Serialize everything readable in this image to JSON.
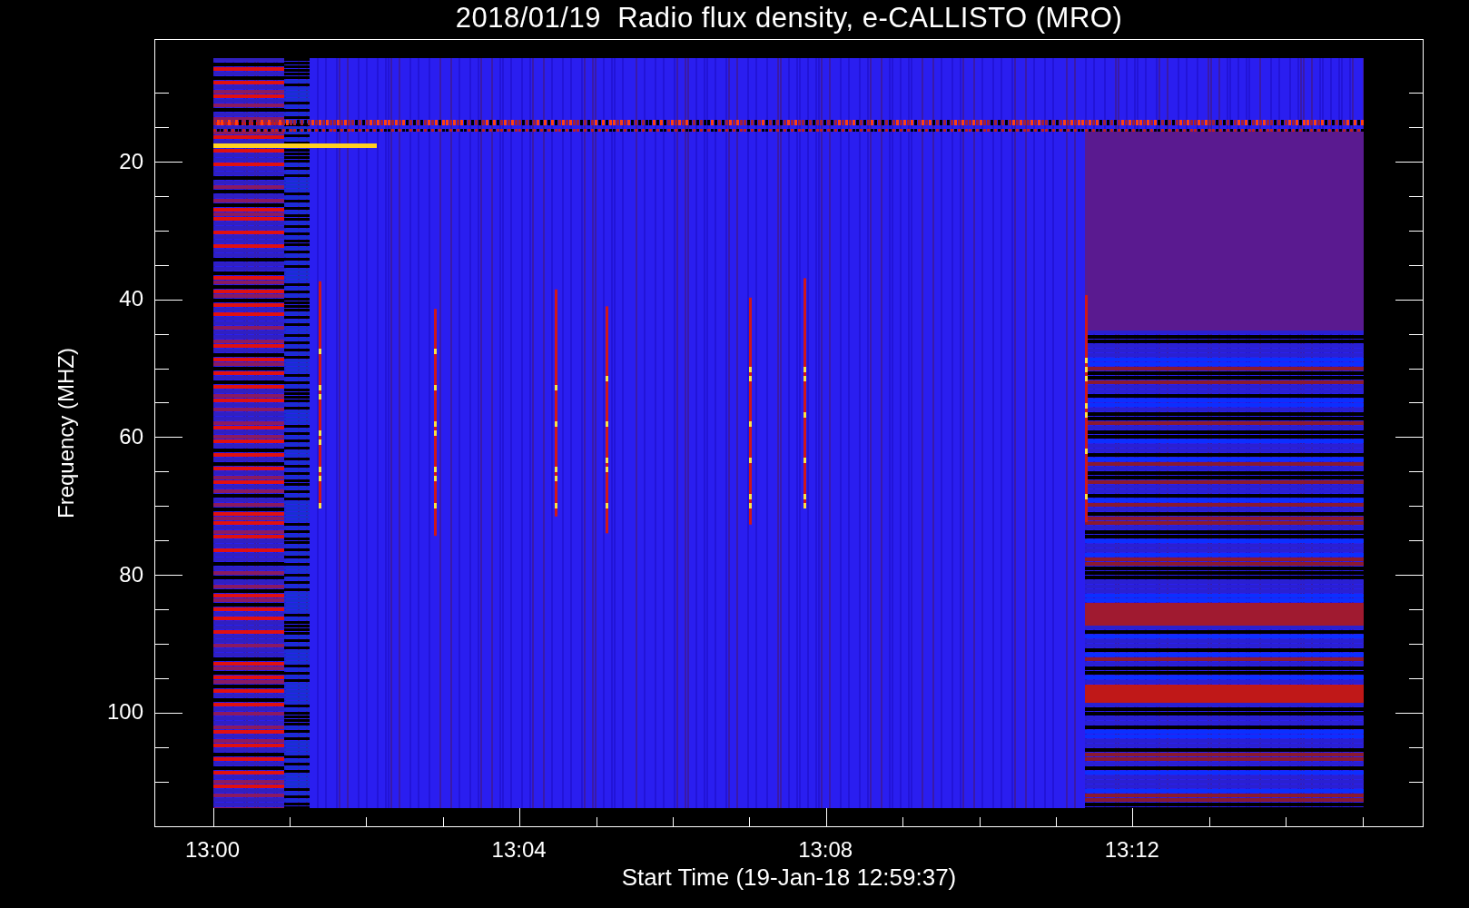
{
  "plot": {
    "title": "2018/01/19  Radio flux density, e-CALLISTO (MRO)",
    "ylabel": "Frequency (MHZ)",
    "xlabel": "Start Time (19-Jan-18 12:59:37)",
    "yticks": [
      "20",
      "40",
      "60",
      "80",
      "100"
    ],
    "xticks": [
      "13:00",
      "13:04",
      "13:08",
      "13:12"
    ]
  }
}
